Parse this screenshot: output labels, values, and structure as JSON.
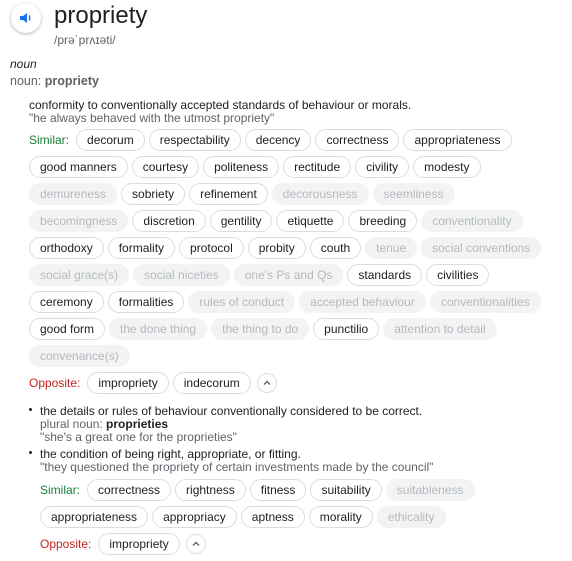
{
  "entry": {
    "word": "propriety",
    "pronunciation": "/prəˈprʌɪəti/",
    "part_of_speech": "noun",
    "noun_label": "noun: ",
    "noun_word": "propriety"
  },
  "sense1": {
    "definition": "conformity to conventionally accepted standards of behaviour or morals.",
    "example": "\"he always behaved with the utmost propriety\"",
    "similar_label": "Similar:",
    "opposite_label": "Opposite:",
    "similar_rows": [
      [
        {
          "t": "decorum",
          "m": false
        },
        {
          "t": "respectability",
          "m": false
        },
        {
          "t": "decency",
          "m": false
        },
        {
          "t": "correctness",
          "m": false
        },
        {
          "t": "appropriateness",
          "m": false
        }
      ],
      [
        {
          "t": "good manners",
          "m": false
        },
        {
          "t": "courtesy",
          "m": false
        },
        {
          "t": "politeness",
          "m": false
        },
        {
          "t": "rectitude",
          "m": false
        },
        {
          "t": "civility",
          "m": false
        },
        {
          "t": "modesty",
          "m": false
        }
      ],
      [
        {
          "t": "demureness",
          "m": true
        },
        {
          "t": "sobriety",
          "m": false
        },
        {
          "t": "refinement",
          "m": false
        },
        {
          "t": "decorousness",
          "m": true
        },
        {
          "t": "seemliness",
          "m": true
        }
      ],
      [
        {
          "t": "becomingness",
          "m": true
        },
        {
          "t": "discretion",
          "m": false
        },
        {
          "t": "gentility",
          "m": false
        },
        {
          "t": "etiquette",
          "m": false
        },
        {
          "t": "breeding",
          "m": false
        },
        {
          "t": "conventionality",
          "m": true
        }
      ],
      [
        {
          "t": "orthodoxy",
          "m": false
        },
        {
          "t": "formality",
          "m": false
        },
        {
          "t": "protocol",
          "m": false
        },
        {
          "t": "probity",
          "m": false
        },
        {
          "t": "couth",
          "m": false
        },
        {
          "t": "tenue",
          "m": true
        },
        {
          "t": "social conventions",
          "m": true
        }
      ],
      [
        {
          "t": "social grace(s)",
          "m": true
        },
        {
          "t": "social niceties",
          "m": true
        },
        {
          "t": "one's Ps and Qs",
          "m": true
        },
        {
          "t": "standards",
          "m": false
        },
        {
          "t": "civilities",
          "m": false
        }
      ],
      [
        {
          "t": "ceremony",
          "m": false
        },
        {
          "t": "formalities",
          "m": false
        },
        {
          "t": "rules of conduct",
          "m": true
        },
        {
          "t": "accepted behaviour",
          "m": true
        },
        {
          "t": "conventionalities",
          "m": true
        }
      ],
      [
        {
          "t": "good form",
          "m": false
        },
        {
          "t": "the done thing",
          "m": true
        },
        {
          "t": "the thing to do",
          "m": true
        },
        {
          "t": "punctilio",
          "m": false
        },
        {
          "t": "attention to detail",
          "m": true
        }
      ],
      [
        {
          "t": "convenance(s)",
          "m": true
        }
      ]
    ],
    "opposites": [
      "impropriety",
      "indecorum"
    ]
  },
  "sense2": {
    "definition": "the details or rules of behaviour conventionally considered to be correct.",
    "plural_label": "plural noun: ",
    "plural_word": "proprieties",
    "example": "\"she's a great one for the proprieties\""
  },
  "sense3": {
    "definition": "the condition of being right, appropriate, or fitting.",
    "example": "\"they questioned the propriety of certain investments made by the council\"",
    "similar_label": "Similar:",
    "opposite_label": "Opposite:",
    "similar_rows": [
      [
        {
          "t": "correctness",
          "m": false
        },
        {
          "t": "rightness",
          "m": false
        },
        {
          "t": "fitness",
          "m": false
        },
        {
          "t": "suitability",
          "m": false
        },
        {
          "t": "suitableness",
          "m": true
        }
      ],
      [
        {
          "t": "appropriateness",
          "m": false
        },
        {
          "t": "appropriacy",
          "m": false
        },
        {
          "t": "aptness",
          "m": false
        },
        {
          "t": "morality",
          "m": false
        },
        {
          "t": "ethicality",
          "m": true
        }
      ]
    ],
    "opposites": [
      "impropriety"
    ]
  },
  "colors": {
    "similar": "#188038",
    "opposite": "#c5221f",
    "speaker": "#1a73e8"
  },
  "icons": {
    "speaker": "speaker-icon",
    "collapse": "chevron-up-icon"
  }
}
